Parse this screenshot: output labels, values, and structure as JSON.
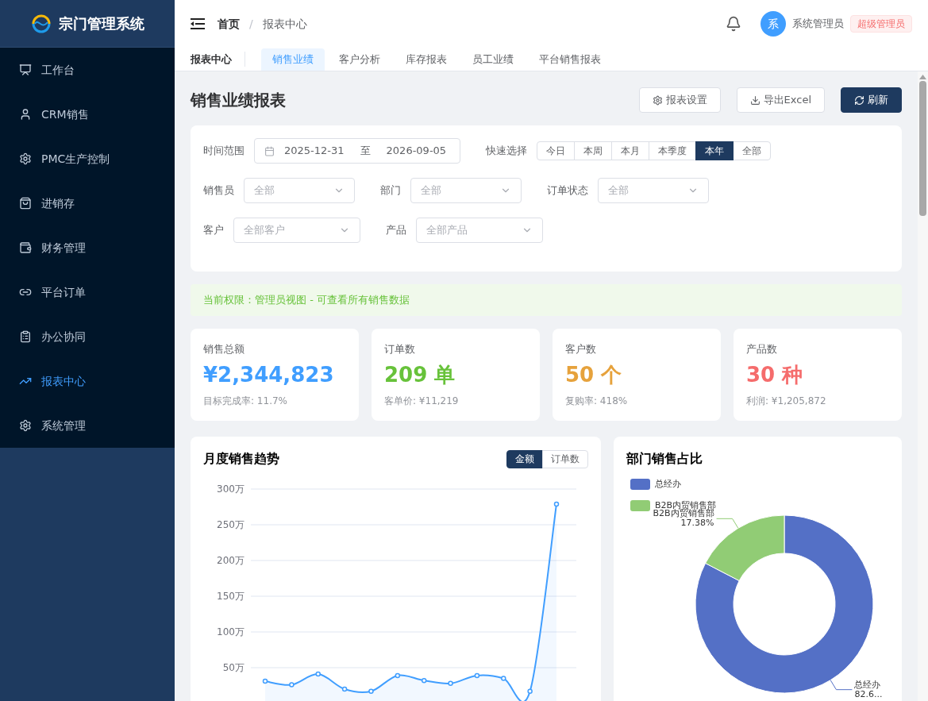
{
  "sidebar": {
    "logo_text": "宗门管理系统",
    "items": [
      {
        "label": "工作台",
        "selected": false
      },
      {
        "label": "CRM销售",
        "selected": false
      },
      {
        "label": "PMC生产控制",
        "selected": false
      },
      {
        "label": "进销存",
        "selected": false
      },
      {
        "label": "财务管理",
        "selected": false
      },
      {
        "label": "平台订单",
        "selected": false
      },
      {
        "label": "办公协同",
        "selected": false
      },
      {
        "label": "报表中心",
        "selected": true
      },
      {
        "label": "系统管理",
        "selected": false
      }
    ]
  },
  "header": {
    "breadcrumbs": [
      {
        "label": "首页"
      },
      {
        "label": "报表中心"
      }
    ],
    "separator": "/",
    "user": {
      "avatar": "系",
      "name": "系统管理员",
      "role": "超级管理员"
    }
  },
  "tabs": {
    "section_title": "报表中心",
    "items": [
      {
        "label": "销售业绩",
        "selected": true
      },
      {
        "label": "客户分析",
        "selected": false
      },
      {
        "label": "库存报表",
        "selected": false
      },
      {
        "label": "员工业绩",
        "selected": false
      },
      {
        "label": "平台销售报表",
        "selected": false
      }
    ]
  },
  "page": {
    "title": "销售业绩报表",
    "buttons": [
      {
        "label": "报表设置",
        "kind": "settings"
      },
      {
        "label": "导出Excel",
        "kind": "export"
      },
      {
        "label": "刷新",
        "kind": "refresh"
      }
    ]
  },
  "filters": {
    "date_range": {
      "label": "时间范围",
      "start": "2025-12-31",
      "separator": "至",
      "end": "2026-09-05"
    },
    "quick_select": {
      "label": "快速选择",
      "options": [
        {
          "label": "今日",
          "selected": false
        },
        {
          "label": "本周",
          "selected": false
        },
        {
          "label": "本月",
          "selected": false
        },
        {
          "label": "本季度",
          "selected": false
        },
        {
          "label": "本年",
          "selected": true
        },
        {
          "label": "全部",
          "selected": false
        }
      ]
    },
    "select_rows": [
      [
        {
          "label": "销售员",
          "placeholder": "全部"
        },
        {
          "label": "部门",
          "placeholder": "全部"
        },
        {
          "label": "订单状态",
          "placeholder": "全部"
        }
      ],
      [
        {
          "label": "客户",
          "placeholder": "全部客户"
        },
        {
          "label": "产品",
          "placeholder": "全部产品"
        }
      ]
    ]
  },
  "notice": "当前权限：管理员视图 - 可查看所有销售数据",
  "stats": [
    {
      "label": "销售总额",
      "value": "¥2,344,823",
      "sub": "目标完成率: 11.7%",
      "color": "#409eff"
    },
    {
      "label": "订单数",
      "value": "209 单",
      "sub": "客单价: ¥11,219",
      "color": "#67c23a"
    },
    {
      "label": "客户数",
      "value": "50 个",
      "sub": "复购率: 418%",
      "color": "#e6a23c"
    },
    {
      "label": "产品数",
      "value": "30 种",
      "sub": "利润: ¥1,205,872",
      "color": "#f56c6c"
    }
  ],
  "trend": {
    "title": "月度销售趋势",
    "toggle": [
      {
        "label": "金额",
        "selected": true
      },
      {
        "label": "订单数",
        "selected": false
      }
    ],
    "chart_data": {
      "type": "area",
      "grid": true,
      "ylim": [
        0,
        300
      ],
      "yticks": [
        {
          "value": 50,
          "label": "50万"
        },
        {
          "value": 100,
          "label": "100万"
        },
        {
          "value": 150,
          "label": "150万"
        },
        {
          "value": 200,
          "label": "200万"
        },
        {
          "value": 250,
          "label": "250万"
        },
        {
          "value": 300,
          "label": "300万"
        }
      ],
      "values": [
        31,
        26,
        41,
        20,
        17,
        39,
        32,
        28,
        39,
        35,
        17,
        279
      ]
    }
  },
  "department": {
    "title": "部门销售占比",
    "chart_data": {
      "type": "donut",
      "categories": [
        "总经办",
        "B2B内贸销售部"
      ],
      "values": [
        82.62,
        17.38
      ],
      "colors": [
        "#5470c6",
        "#91cc75"
      ]
    },
    "slice_labels": [
      {
        "name": "总经办",
        "value": "82.6..."
      },
      {
        "name": "B2B内贸销售部",
        "value": "17.38%"
      }
    ]
  }
}
